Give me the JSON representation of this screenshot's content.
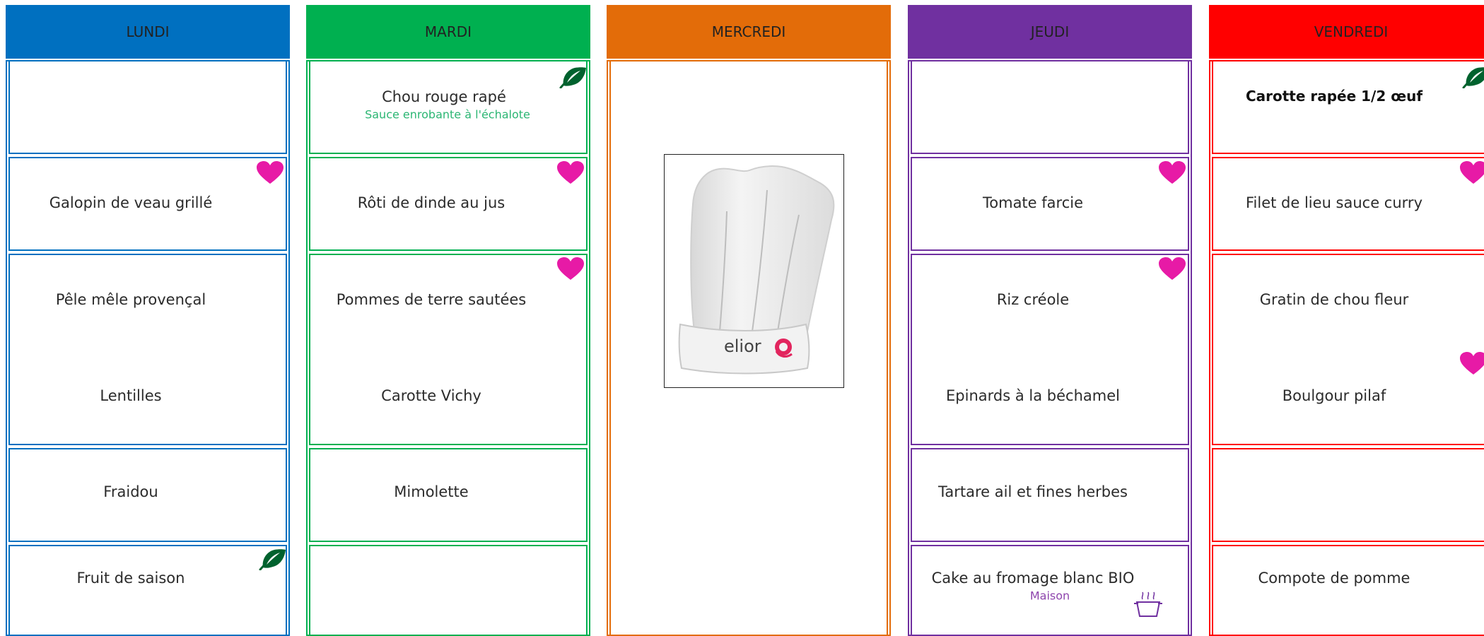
{
  "colors": {
    "lundi": "#0070c0",
    "mardi": "#00b050",
    "mercredi": "#e36c09",
    "jeudi": "#7030a0",
    "vendredi": "#ff0000",
    "heart": "#e71aa6",
    "leaf": "#00622e",
    "sauce_text": "#2bb673",
    "maison_text": "#8e44ad"
  },
  "days": {
    "lundi": "LUNDI",
    "mardi": "MARDI",
    "mercredi": "MERCREDI",
    "jeudi": "JEUDI",
    "vendredi": "VENDREDI"
  },
  "lundi": {
    "entree": "",
    "plat": "Galopin de veau grillé",
    "accompagnement_1": "Pêle mêle provençal",
    "accompagnement_2": "Lentilles",
    "fromage": "Fraidou",
    "dessert": "Fruit de saison"
  },
  "mardi": {
    "entree": "Chou rouge rapé",
    "entree_sauce": "Sauce enrobante à l'échalote",
    "plat": "Rôti de dinde au jus",
    "accompagnement_1": "Pommes de terre sautées",
    "accompagnement_2": "Carotte Vichy",
    "fromage": "Mimolette",
    "dessert": ""
  },
  "mercredi": {
    "logo_text": "elior"
  },
  "jeudi": {
    "entree": "",
    "plat": "Tomate farcie",
    "accompagnement_1": "Riz créole",
    "accompagnement_2": "Epinards à la béchamel",
    "fromage": "Tartare ail et fines herbes",
    "dessert": "Cake au fromage blanc BIO",
    "dessert_note": "Maison"
  },
  "vendredi": {
    "entree": "Carotte rapée 1/2 œuf",
    "plat": "Filet de lieu sauce curry",
    "accompagnement_1": "Gratin de chou fleur",
    "accompagnement_2": "Boulgour pilaf",
    "fromage": "",
    "dessert": "Compote de pomme"
  },
  "icons": [
    "heart-icon",
    "leaf-icon",
    "homemade-pot-icon",
    "chef-hat-logo"
  ]
}
